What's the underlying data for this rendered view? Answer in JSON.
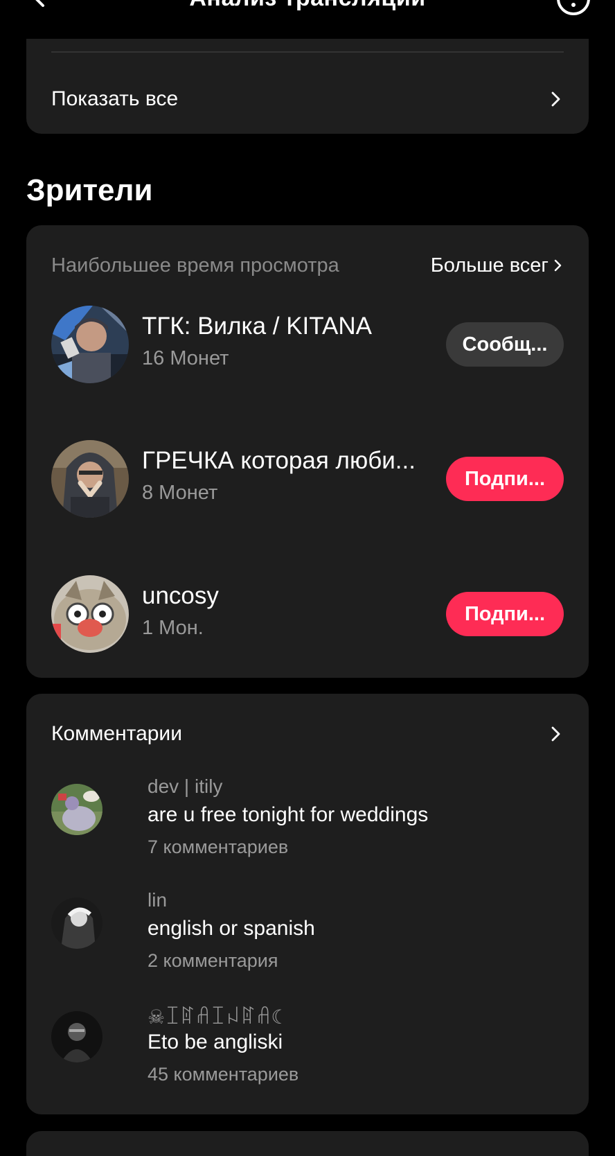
{
  "header": {
    "title": "Анализ трансляции",
    "back_icon": "chevron-left-icon",
    "info_icon": "info-icon"
  },
  "top_card": {
    "show_all_label": "Показать все"
  },
  "viewers": {
    "section_title": "Зрители",
    "subtitle": "Наибольшее время просмотра",
    "more_label": "Больше всег",
    "items": [
      {
        "name": "ТГК: Вилка / KITANA",
        "coins": "16 Монет",
        "button": "Сообщ...",
        "button_style": "gray"
      },
      {
        "name": "ГРЕЧКА которая люби...",
        "coins": "8 Монет",
        "button": "Подпи...",
        "button_style": "red"
      },
      {
        "name": "uncosy",
        "coins": "1 Мон.",
        "button": "Подпи...",
        "button_style": "red"
      }
    ]
  },
  "comments": {
    "title": "Комментарии",
    "items": [
      {
        "user": "dev | itily",
        "text": "are u free tonight for weddings",
        "count": "7 комментариев"
      },
      {
        "user": "lin",
        "text": "english or spanish",
        "count": "2 комментария"
      },
      {
        "user": "☠ꀤꍏꋬꀤꈤꍏꋬ☾",
        "text": "Eto be angliski",
        "count": "45 комментариев"
      }
    ]
  },
  "colors": {
    "background": "#000000",
    "card": "#1e1e1e",
    "accent_red": "#fe2c55",
    "pill_gray": "#3a3a3a",
    "secondary_text": "#9a9a9a"
  }
}
